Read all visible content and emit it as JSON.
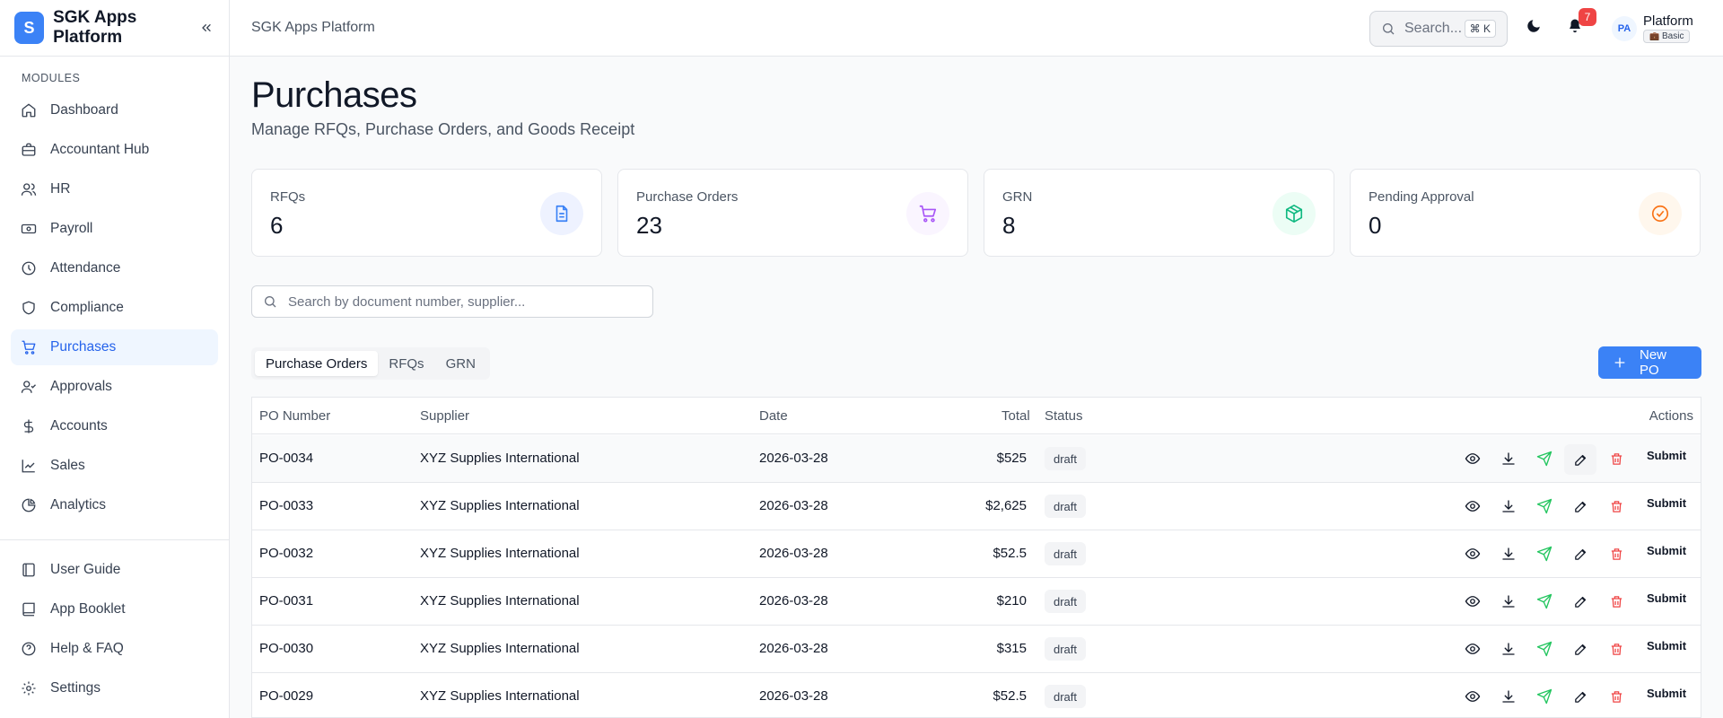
{
  "sidebar": {
    "brand_letter": "S",
    "brand_name": "SGK Apps Platform",
    "section_label": "MODULES",
    "items": [
      {
        "label": "Dashboard",
        "icon": "home-icon"
      },
      {
        "label": "Accountant Hub",
        "icon": "briefcase-icon"
      },
      {
        "label": "HR",
        "icon": "users-icon"
      },
      {
        "label": "Payroll",
        "icon": "banknote-icon"
      },
      {
        "label": "Attendance",
        "icon": "clock-icon"
      },
      {
        "label": "Compliance",
        "icon": "shield-icon"
      },
      {
        "label": "Purchases",
        "icon": "cart-icon"
      },
      {
        "label": "Approvals",
        "icon": "person-check-icon"
      },
      {
        "label": "Accounts",
        "icon": "dollar-icon"
      },
      {
        "label": "Sales",
        "icon": "trend-icon"
      },
      {
        "label": "Analytics",
        "icon": "chart-icon"
      }
    ],
    "bottom_items": [
      {
        "label": "User Guide",
        "icon": "book-icon"
      },
      {
        "label": "App Booklet",
        "icon": "booklet-icon"
      },
      {
        "label": "Help & FAQ",
        "icon": "help-icon"
      },
      {
        "label": "Settings",
        "icon": "gear-icon"
      }
    ]
  },
  "topbar": {
    "title": "SGK Apps Platform",
    "search_placeholder": "Search...",
    "search_shortcut": "⌘ K",
    "notification_count": "7",
    "avatar_initials": "PA",
    "user_name": "Platform",
    "plan": "Basic"
  },
  "page": {
    "title": "Purchases",
    "subtitle": "Manage RFQs, Purchase Orders, and Goods Receipt"
  },
  "stats": [
    {
      "label": "RFQs",
      "value": "6",
      "icon": "document-icon",
      "bg": "#eef2ff",
      "color": "#3b82f6"
    },
    {
      "label": "Purchase Orders",
      "value": "23",
      "icon": "cart-icon",
      "bg": "#faf5ff",
      "color": "#a855f7"
    },
    {
      "label": "GRN",
      "value": "8",
      "icon": "package-icon",
      "bg": "#ecfdf5",
      "color": "#10b981"
    },
    {
      "label": "Pending Approval",
      "value": "0",
      "icon": "check-circle-icon",
      "bg": "#fff7ed",
      "color": "#f97316"
    }
  ],
  "search": {
    "placeholder": "Search by document number, supplier..."
  },
  "tabs": [
    "Purchase Orders",
    "RFQs",
    "GRN"
  ],
  "new_button": "New PO",
  "table": {
    "columns": [
      "PO Number",
      "Supplier",
      "Date",
      "Total",
      "Status",
      "Actions"
    ],
    "rows": [
      {
        "po": "PO-0034",
        "supplier": "XYZ Supplies International",
        "date": "2026-03-28",
        "total": "$525",
        "status": "draft",
        "action": "Submit"
      },
      {
        "po": "PO-0033",
        "supplier": "XYZ Supplies International",
        "date": "2026-03-28",
        "total": "$2,625",
        "status": "draft",
        "action": "Submit"
      },
      {
        "po": "PO-0032",
        "supplier": "XYZ Supplies International",
        "date": "2026-03-28",
        "total": "$52.5",
        "status": "draft",
        "action": "Submit"
      },
      {
        "po": "PO-0031",
        "supplier": "XYZ Supplies International",
        "date": "2026-03-28",
        "total": "$210",
        "status": "draft",
        "action": "Submit"
      },
      {
        "po": "PO-0030",
        "supplier": "XYZ Supplies International",
        "date": "2026-03-28",
        "total": "$315",
        "status": "draft",
        "action": "Submit"
      },
      {
        "po": "PO-0029",
        "supplier": "XYZ Supplies International",
        "date": "2026-03-28",
        "total": "$52.5",
        "status": "draft",
        "action": "Submit"
      }
    ]
  },
  "colors": {
    "accent": "#3b82f6",
    "active_nav_bg": "#eff6ff",
    "send_icon": "#22c55e",
    "delete_icon": "#ef4444"
  }
}
